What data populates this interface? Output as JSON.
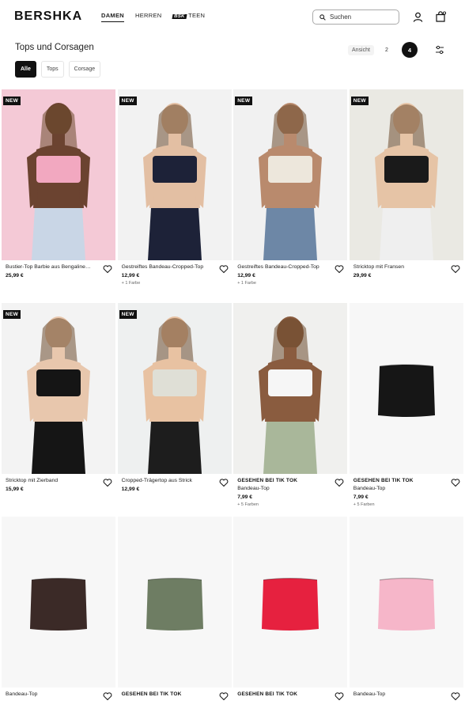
{
  "header": {
    "logo": "BERSHKA",
    "nav": [
      {
        "label": "DAMEN",
        "active": true
      },
      {
        "label": "HERREN",
        "active": false
      },
      {
        "label": "TEEN",
        "active": false,
        "badge": "BSK"
      }
    ],
    "search_label": "Suchen"
  },
  "page": {
    "title": "Tops und Corsagen",
    "view_label": "Ansicht",
    "view_options": [
      "2",
      "4"
    ],
    "view_selected": "4",
    "filters": [
      {
        "label": "Alle",
        "active": true
      },
      {
        "label": "Tops",
        "active": false
      },
      {
        "label": "Corsage",
        "active": false
      }
    ]
  },
  "products": [
    {
      "badge": "NEW",
      "tag": "",
      "name": "Bustier-Top Barbie aus Bengaline…",
      "price": "25,99 €",
      "colors": "",
      "bg": "#f4c9d6",
      "garment": "#f2a8c0",
      "skin": "#6b4330",
      "bottom": "#c9d6e6"
    },
    {
      "badge": "NEW",
      "tag": "",
      "name": "Gestreiftes Bandeau-Cropped-Top",
      "price": "12,99 €",
      "colors": "+ 1 Farbe",
      "bg": "#f2f2f2",
      "garment": "#1d2238",
      "skin": "#e3bfa3",
      "bottom": "#1d2238"
    },
    {
      "badge": "NEW",
      "tag": "",
      "name": "Gestreiftes Bandeau-Cropped-Top",
      "price": "12,99 €",
      "colors": "+ 1 Farbe",
      "bg": "#f1f1f1",
      "garment": "#ede7dc",
      "skin": "#b98a6d",
      "bottom": "#6d87a6"
    },
    {
      "badge": "NEW",
      "tag": "",
      "name": "Stricktop mit Fransen",
      "price": "29,99 €",
      "colors": "",
      "bg": "#eae9e3",
      "garment": "#1a1a1a",
      "skin": "#e6c4a6",
      "bottom": "#efefef"
    },
    {
      "badge": "NEW",
      "tag": "",
      "name": "Stricktop mit Zierband",
      "price": "15,99 €",
      "colors": "",
      "bg": "#f3f3f3",
      "garment": "#151515",
      "skin": "#e8c7ad",
      "bottom": "#151515"
    },
    {
      "badge": "NEW",
      "tag": "",
      "name": "Cropped-Trägertop aus Strick",
      "price": "12,99 €",
      "colors": "",
      "bg": "#eef0f0",
      "garment": "#dfdfd6",
      "skin": "#e8c2a2",
      "bottom": "#1d1d1d"
    },
    {
      "badge": "",
      "tag": "GESEHEN BEI TIK TOK",
      "name": "Bandeau-Top",
      "price": "7,99 €",
      "colors": "+ 5 Farben",
      "bg": "#f0f0ee",
      "garment": "#f6f6f6",
      "skin": "#8a5c3f",
      "bottom": "#a9b79a"
    },
    {
      "badge": "",
      "tag": "GESEHEN BEI TIK TOK",
      "name": "Bandeau-Top",
      "price": "7,99 €",
      "colors": "+ 5 Farben",
      "bg": "#f7f7f7",
      "garment": "#161616",
      "skin": "",
      "bottom": ""
    },
    {
      "badge": "",
      "tag": "",
      "name": "Bandeau-Top",
      "price": "",
      "colors": "",
      "bg": "#f7f7f7",
      "garment": "#3b2a27",
      "skin": "",
      "bottom": ""
    },
    {
      "badge": "",
      "tag": "GESEHEN BEI TIK TOK",
      "name": "",
      "price": "",
      "colors": "",
      "bg": "#f7f7f7",
      "garment": "#6e7d63",
      "skin": "",
      "bottom": ""
    },
    {
      "badge": "",
      "tag": "GESEHEN BEI TIK TOK",
      "name": "",
      "price": "",
      "colors": "",
      "bg": "#f7f7f7",
      "garment": "#e6213f",
      "skin": "",
      "bottom": ""
    },
    {
      "badge": "",
      "tag": "",
      "name": "Bandeau-Top",
      "price": "",
      "colors": "",
      "bg": "#f7f7f7",
      "garment": "#f6b6c9",
      "skin": "",
      "bottom": ""
    }
  ]
}
